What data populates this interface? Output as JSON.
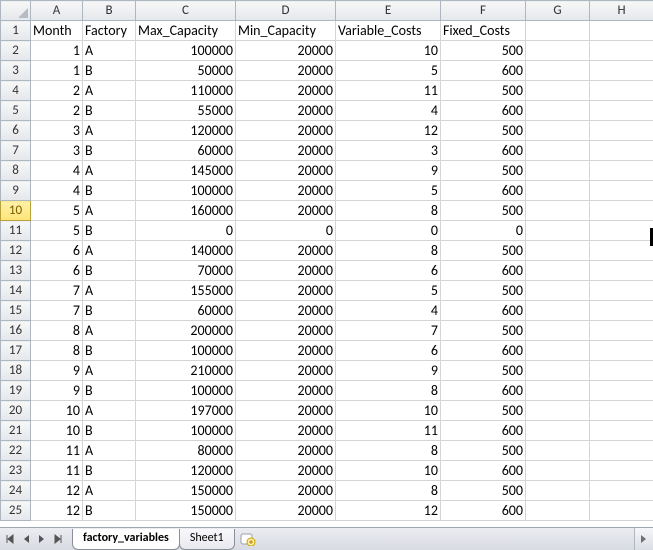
{
  "columns": [
    "A",
    "B",
    "C",
    "D",
    "E",
    "F",
    "G",
    "H"
  ],
  "headers": {
    "A": "Month",
    "B": "Factory",
    "C": "Max_Capacity",
    "D": "Min_Capacity",
    "E": "Variable_Costs",
    "F": "Fixed_Costs"
  },
  "rows": [
    {
      "n": 2,
      "Month": 1,
      "Factory": "A",
      "Max": 100000,
      "Min": 20000,
      "Var": 10,
      "Fix": 500
    },
    {
      "n": 3,
      "Month": 1,
      "Factory": "B",
      "Max": 50000,
      "Min": 20000,
      "Var": 5,
      "Fix": 600
    },
    {
      "n": 4,
      "Month": 2,
      "Factory": "A",
      "Max": 110000,
      "Min": 20000,
      "Var": 11,
      "Fix": 500
    },
    {
      "n": 5,
      "Month": 2,
      "Factory": "B",
      "Max": 55000,
      "Min": 20000,
      "Var": 4,
      "Fix": 600
    },
    {
      "n": 6,
      "Month": 3,
      "Factory": "A",
      "Max": 120000,
      "Min": 20000,
      "Var": 12,
      "Fix": 500
    },
    {
      "n": 7,
      "Month": 3,
      "Factory": "B",
      "Max": 60000,
      "Min": 20000,
      "Var": 3,
      "Fix": 600
    },
    {
      "n": 8,
      "Month": 4,
      "Factory": "A",
      "Max": 145000,
      "Min": 20000,
      "Var": 9,
      "Fix": 500
    },
    {
      "n": 9,
      "Month": 4,
      "Factory": "B",
      "Max": 100000,
      "Min": 20000,
      "Var": 5,
      "Fix": 600
    },
    {
      "n": 10,
      "Month": 5,
      "Factory": "A",
      "Max": 160000,
      "Min": 20000,
      "Var": 8,
      "Fix": 500
    },
    {
      "n": 11,
      "Month": 5,
      "Factory": "B",
      "Max": 0,
      "Min": 0,
      "Var": 0,
      "Fix": 0
    },
    {
      "n": 12,
      "Month": 6,
      "Factory": "A",
      "Max": 140000,
      "Min": 20000,
      "Var": 8,
      "Fix": 500
    },
    {
      "n": 13,
      "Month": 6,
      "Factory": "B",
      "Max": 70000,
      "Min": 20000,
      "Var": 6,
      "Fix": 600
    },
    {
      "n": 14,
      "Month": 7,
      "Factory": "A",
      "Max": 155000,
      "Min": 20000,
      "Var": 5,
      "Fix": 500
    },
    {
      "n": 15,
      "Month": 7,
      "Factory": "B",
      "Max": 60000,
      "Min": 20000,
      "Var": 4,
      "Fix": 600
    },
    {
      "n": 16,
      "Month": 8,
      "Factory": "A",
      "Max": 200000,
      "Min": 20000,
      "Var": 7,
      "Fix": 500
    },
    {
      "n": 17,
      "Month": 8,
      "Factory": "B",
      "Max": 100000,
      "Min": 20000,
      "Var": 6,
      "Fix": 600
    },
    {
      "n": 18,
      "Month": 9,
      "Factory": "A",
      "Max": 210000,
      "Min": 20000,
      "Var": 9,
      "Fix": 500
    },
    {
      "n": 19,
      "Month": 9,
      "Factory": "B",
      "Max": 100000,
      "Min": 20000,
      "Var": 8,
      "Fix": 600
    },
    {
      "n": 20,
      "Month": 10,
      "Factory": "A",
      "Max": 197000,
      "Min": 20000,
      "Var": 10,
      "Fix": 500
    },
    {
      "n": 21,
      "Month": 10,
      "Factory": "B",
      "Max": 100000,
      "Min": 20000,
      "Var": 11,
      "Fix": 600
    },
    {
      "n": 22,
      "Month": 11,
      "Factory": "A",
      "Max": 80000,
      "Min": 20000,
      "Var": 8,
      "Fix": 500
    },
    {
      "n": 23,
      "Month": 11,
      "Factory": "B",
      "Max": 120000,
      "Min": 20000,
      "Var": 10,
      "Fix": 600
    },
    {
      "n": 24,
      "Month": 12,
      "Factory": "A",
      "Max": 150000,
      "Min": 20000,
      "Var": 8,
      "Fix": 500
    },
    {
      "n": 25,
      "Month": 12,
      "Factory": "B",
      "Max": 150000,
      "Min": 20000,
      "Var": 12,
      "Fix": 600
    }
  ],
  "selected_row": 10,
  "tabs": {
    "active": "factory_variables",
    "items": [
      "factory_variables",
      "Sheet1"
    ]
  }
}
